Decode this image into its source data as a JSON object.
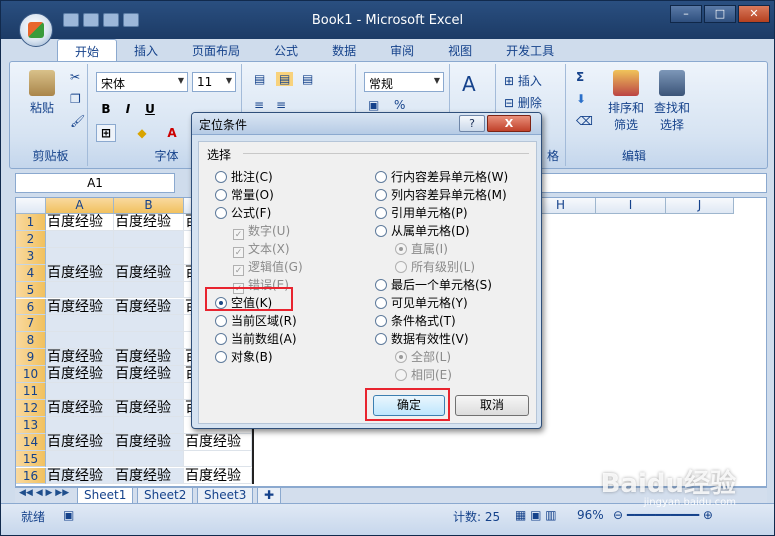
{
  "window": {
    "title": "Book1 - Microsoft Excel"
  },
  "ribbon_tabs": [
    "开始",
    "插入",
    "页面布局",
    "公式",
    "数据",
    "审阅",
    "视图",
    "开发工具"
  ],
  "ribbon": {
    "clipboard": {
      "paste": "粘贴",
      "label": "剪贴板"
    },
    "font": {
      "name": "宋体",
      "size": "11",
      "bold": "B",
      "italic": "I",
      "underline": "U",
      "label": "字体"
    },
    "number": {
      "format": "常规"
    },
    "cells": {
      "insert": "插入",
      "delete": "删除",
      "label": "格"
    },
    "editing": {
      "sort": "排序和",
      "sort2": "筛选",
      "find": "查找和",
      "find2": "选择",
      "label": "编辑"
    }
  },
  "formula_bar": {
    "name_box": "A1",
    "value": ""
  },
  "columns": [
    "A",
    "B",
    "H",
    "I",
    "J"
  ],
  "rows": [
    {
      "n": "1",
      "a": "百度经验",
      "b": "百度经验",
      "c": "百"
    },
    {
      "n": "2",
      "a": "",
      "b": "",
      "c": ""
    },
    {
      "n": "3",
      "a": "",
      "b": "",
      "c": ""
    },
    {
      "n": "4",
      "a": "百度经验",
      "b": "百度经验",
      "c": "百"
    },
    {
      "n": "5",
      "a": "",
      "b": "",
      "c": ""
    },
    {
      "n": "6",
      "a": "百度经验",
      "b": "百度经验",
      "c": "百"
    },
    {
      "n": "7",
      "a": "",
      "b": "",
      "c": ""
    },
    {
      "n": "8",
      "a": "",
      "b": "",
      "c": ""
    },
    {
      "n": "9",
      "a": "百度经验",
      "b": "百度经验",
      "c": "百"
    },
    {
      "n": "10",
      "a": "百度经验",
      "b": "百度经验",
      "c": "百"
    },
    {
      "n": "11",
      "a": "",
      "b": "",
      "c": ""
    },
    {
      "n": "12",
      "a": "百度经验",
      "b": "百度经验",
      "c": "百"
    },
    {
      "n": "13",
      "a": "",
      "b": "",
      "c": ""
    },
    {
      "n": "14",
      "a": "百度经验",
      "b": "百度经验",
      "c": "百度经验"
    },
    {
      "n": "15",
      "a": "",
      "b": "",
      "c": ""
    },
    {
      "n": "16",
      "a": "百度经验",
      "b": "百度经验",
      "c": "百度经验"
    }
  ],
  "sheet_tabs": [
    "Sheet1",
    "Sheet2",
    "Sheet3"
  ],
  "status": {
    "ready": "就绪",
    "count": "计数: 25",
    "zoom": "96%"
  },
  "dialog": {
    "title": "定位条件",
    "help": "?",
    "close": "X",
    "group_label": "选择",
    "left_options": [
      {
        "label": "批注(C)",
        "checked": false
      },
      {
        "label": "常量(O)",
        "checked": false
      },
      {
        "label": "公式(F)",
        "checked": false
      },
      {
        "label": "空值(K)",
        "checked": true
      },
      {
        "label": "当前区域(R)",
        "checked": false
      },
      {
        "label": "当前数组(A)",
        "checked": false
      },
      {
        "label": "对象(B)",
        "checked": false
      }
    ],
    "formula_subs": [
      "数字(U)",
      "文本(X)",
      "逻辑值(G)",
      "错误(E)"
    ],
    "right_options": [
      {
        "label": "行内容差异单元格(W)",
        "checked": false
      },
      {
        "label": "列内容差异单元格(M)",
        "checked": false
      },
      {
        "label": "引用单元格(P)",
        "checked": false
      },
      {
        "label": "从属单元格(D)",
        "checked": false
      },
      {
        "label": "最后一个单元格(S)",
        "checked": false
      },
      {
        "label": "可见单元格(Y)",
        "checked": false
      },
      {
        "label": "条件格式(T)",
        "checked": false
      },
      {
        "label": "数据有效性(V)",
        "checked": false
      }
    ],
    "dependents_subs": [
      {
        "label": "直属(I)",
        "checked": true
      },
      {
        "label": "所有级别(L)",
        "checked": false
      }
    ],
    "validation_subs": [
      {
        "label": "全部(L)",
        "checked": true
      },
      {
        "label": "相同(E)",
        "checked": false
      }
    ],
    "ok": "确定",
    "cancel": "取消"
  },
  "watermark": {
    "text": "Baidu经验",
    "url": "jingyan.baidu.com"
  }
}
